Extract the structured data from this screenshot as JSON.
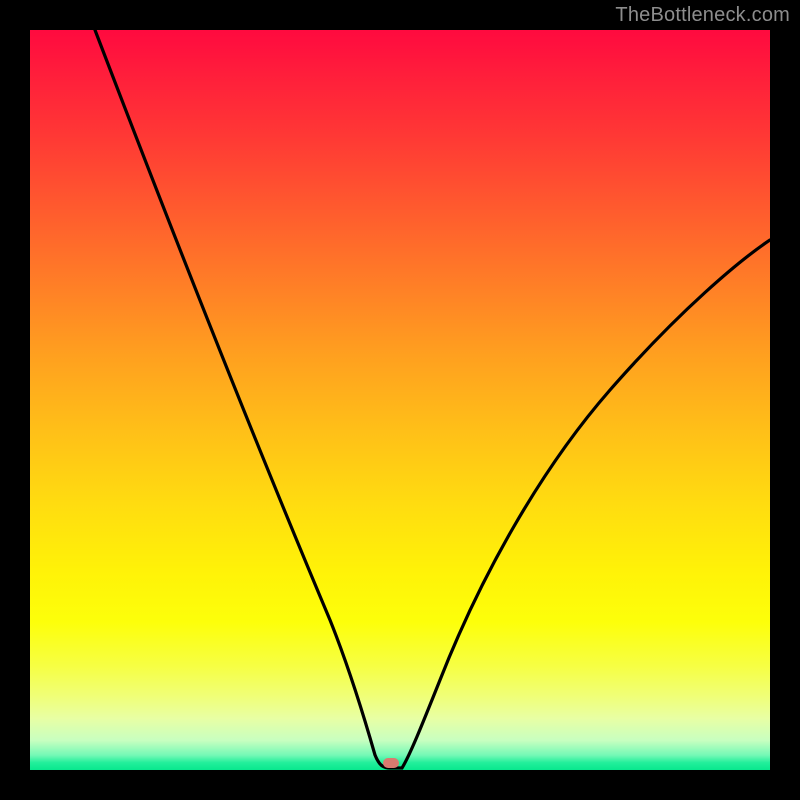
{
  "watermark": "TheBottleneck.com",
  "marker": {
    "x_frac": 0.486,
    "y_frac": 0.992
  },
  "chart_data": {
    "type": "line",
    "title": "",
    "xlabel": "",
    "ylabel": "",
    "xlim": [
      0,
      1
    ],
    "ylim": [
      0,
      1
    ],
    "series": [
      {
        "name": "bottleneck-curve",
        "x": [
          0.0,
          0.05,
          0.1,
          0.15,
          0.2,
          0.25,
          0.3,
          0.35,
          0.4,
          0.44,
          0.47,
          0.49,
          0.5,
          0.53,
          0.57,
          0.62,
          0.68,
          0.75,
          0.83,
          0.91,
          1.0
        ],
        "y": [
          1.0,
          0.9,
          0.8,
          0.7,
          0.6,
          0.5,
          0.4,
          0.3,
          0.19,
          0.1,
          0.04,
          0.01,
          0.01,
          0.05,
          0.13,
          0.23,
          0.33,
          0.43,
          0.52,
          0.59,
          0.65
        ]
      }
    ],
    "background_gradient": {
      "direction": "vertical",
      "stops": [
        {
          "pos": 0.0,
          "color": "#ff0a3f"
        },
        {
          "pos": 0.5,
          "color": "#ffbf18"
        },
        {
          "pos": 0.8,
          "color": "#fdff0a"
        },
        {
          "pos": 1.0,
          "color": "#08e88e"
        }
      ]
    },
    "marker_point": {
      "x": 0.486,
      "y": 0.008,
      "color": "#d97a6f"
    }
  }
}
